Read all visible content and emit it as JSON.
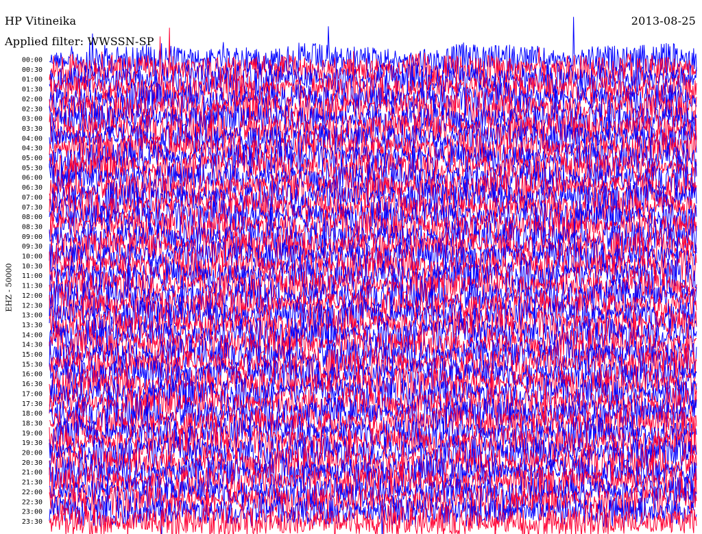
{
  "header": {
    "station": "HP Vitineika",
    "date": "2013-08-25",
    "filter": "Applied filter: WWSSN-SP"
  },
  "channel_label": "EHZ - 50000",
  "colors": {
    "trace_a": "#0000ff",
    "trace_b": "#ff0033",
    "clip": "#ffffff"
  },
  "chart_data": {
    "type": "line",
    "title": "HP Vitineika",
    "subtitle": "Applied filter: WWSSN-SP",
    "ylabel": "EHZ - 50000",
    "xlabel": "",
    "row_labels": [
      "00:00",
      "00:30",
      "01:00",
      "01:30",
      "02:00",
      "02:30",
      "03:00",
      "03:30",
      "04:00",
      "04:30",
      "05:00",
      "05:30",
      "06:00",
      "06:30",
      "07:00",
      "07:30",
      "08:00",
      "08:30",
      "09:00",
      "09:30",
      "10:00",
      "10:30",
      "11:00",
      "11:30",
      "12:00",
      "12:30",
      "13:00",
      "13:30",
      "14:00",
      "14:30",
      "15:00",
      "15:30",
      "16:00",
      "16:30",
      "17:00",
      "17:30",
      "18:00",
      "18:30",
      "19:00",
      "19:30",
      "20:00",
      "20:30",
      "21:00",
      "21:30",
      "22:00",
      "22:30",
      "23:00",
      "23:30"
    ],
    "series": [
      {
        "name": "",
        "color": "#0000ff",
        "rows": "even"
      },
      {
        "name": "",
        "color": "#ff0033",
        "rows": "odd"
      }
    ],
    "rows_per_hour": 2,
    "minutes_per_row": 30,
    "grid": false,
    "legend": "none"
  }
}
